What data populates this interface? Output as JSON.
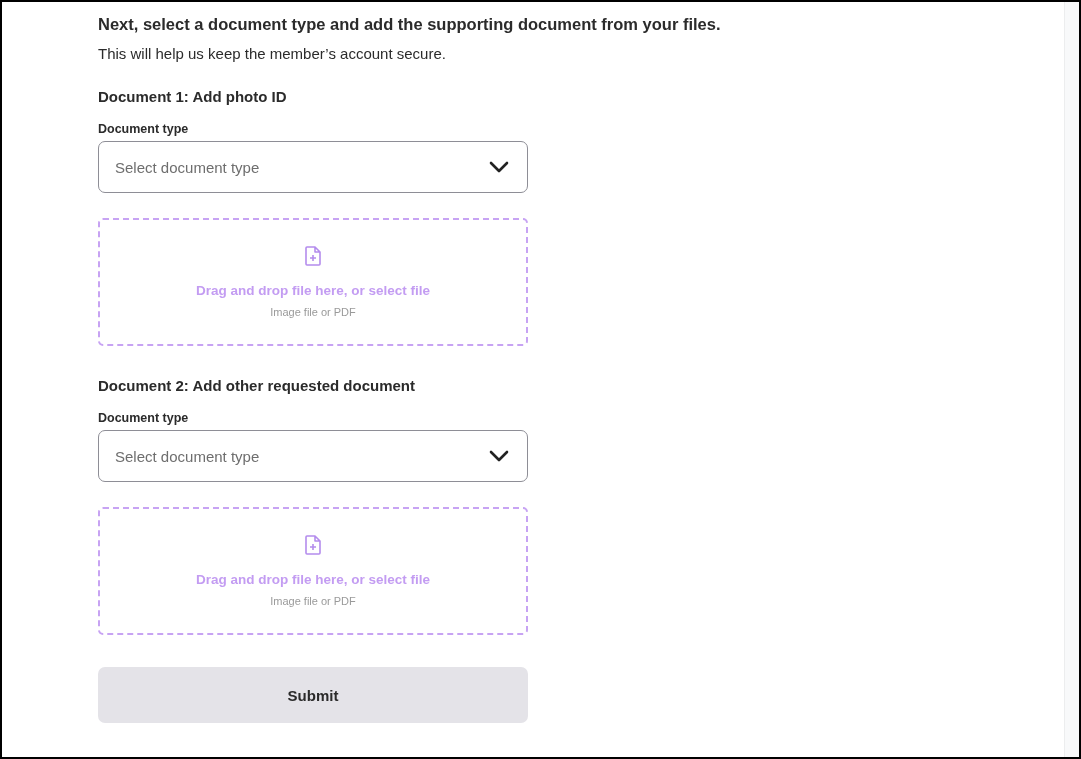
{
  "heading": "Next, select a document type and add the supporting document from your files.",
  "subtitle": "This will help us keep the member’s account secure.",
  "documents": [
    {
      "title": "Document 1: Add photo ID",
      "type_label": "Document type",
      "select": {
        "placeholder": "Select document type"
      },
      "dropzone": {
        "action": "Drag and drop file here, or select file",
        "hint": "Image file or PDF"
      }
    },
    {
      "title": "Document 2: Add other requested document",
      "type_label": "Document type",
      "select": {
        "placeholder": "Select document type"
      },
      "dropzone": {
        "action": "Drag and drop file here, or select file",
        "hint": "Image file or PDF"
      }
    }
  ],
  "submit": {
    "label": "Submit"
  }
}
